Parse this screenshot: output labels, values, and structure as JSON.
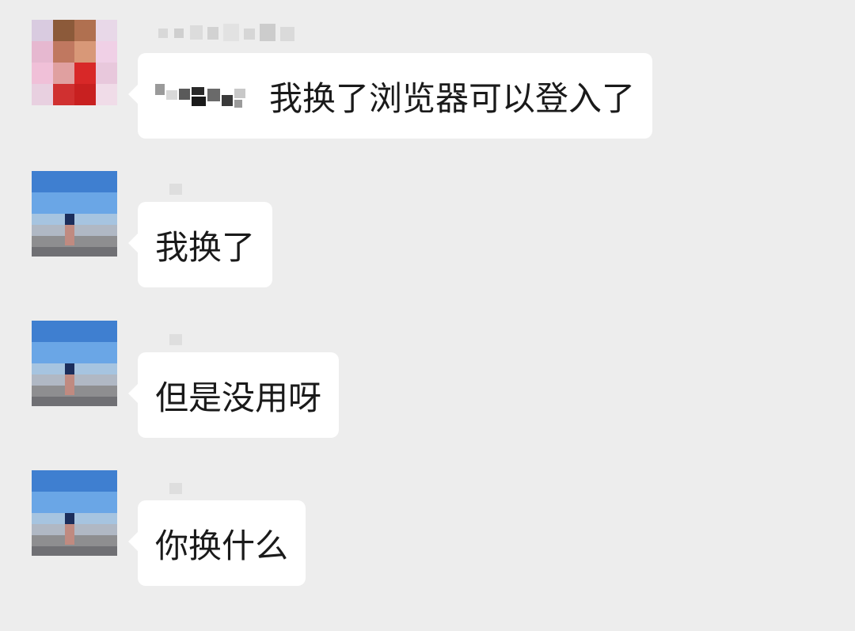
{
  "messages": [
    {
      "sender": "user_a",
      "avatar_icon": "avatar-red-shirt-pixelated",
      "mention": "@",
      "text": "我换了浏览器可以登入了"
    },
    {
      "sender": "user_b",
      "avatar_icon": "avatar-sky-pixelated",
      "text": "我换了"
    },
    {
      "sender": "user_b",
      "avatar_icon": "avatar-sky-pixelated",
      "text": "但是没用呀"
    },
    {
      "sender": "user_b",
      "avatar_icon": "avatar-sky-pixelated",
      "text": "你换什么"
    }
  ],
  "colors": {
    "background": "#ededed",
    "bubble": "#ffffff",
    "text": "#1a1a1a"
  }
}
